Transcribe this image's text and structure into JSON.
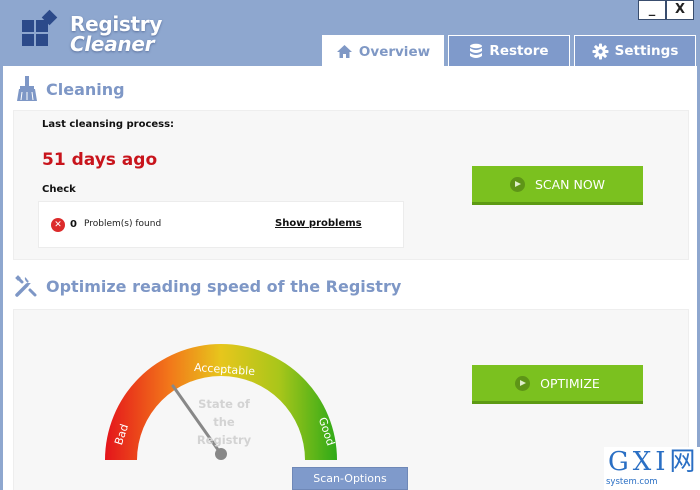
{
  "app": {
    "logo_line1": "Registry",
    "logo_line2": "Cleaner",
    "minimize_label": "_",
    "close_label": "X"
  },
  "tabs": [
    {
      "label": "Overview",
      "icon": "home-icon",
      "active": true
    },
    {
      "label": "Restore",
      "icon": "database-icon",
      "active": false
    },
    {
      "label": "Settings",
      "icon": "gear-icon",
      "active": false
    }
  ],
  "cleaning": {
    "title": "Cleaning",
    "last_label": "Last cleansing process:",
    "days_ago": "51 days ago",
    "check_label": "Check",
    "problems_count": "0",
    "problems_text": "Problem(s) found",
    "show_problems": "Show problems",
    "scan_button": "SCAN NOW"
  },
  "optimize": {
    "title": "Optimize reading speed of the Registry",
    "gauge_bad": "Bad",
    "gauge_acceptable": "Acceptable",
    "gauge_good": "Good",
    "gauge_state_line1": "State of",
    "gauge_state_line2": "the Registry",
    "optimize_button": "OPTIMIZE"
  },
  "footer": {
    "scan_options": "Scan-Options"
  },
  "watermark": {
    "main": "GXI网",
    "sub": "system.com"
  },
  "colors": {
    "accent": "#7f9acb",
    "title_blue": "#7e97c6",
    "danger": "#c8141c",
    "button_green": "#7bc11f"
  }
}
